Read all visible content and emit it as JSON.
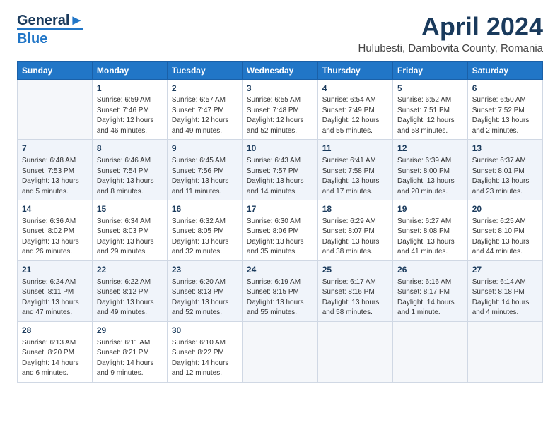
{
  "header": {
    "logo_line1": "General",
    "logo_line2": "Blue",
    "month": "April 2024",
    "location": "Hulubesti, Dambovita County, Romania"
  },
  "weekdays": [
    "Sunday",
    "Monday",
    "Tuesday",
    "Wednesday",
    "Thursday",
    "Friday",
    "Saturday"
  ],
  "weeks": [
    [
      {
        "day": "",
        "sunrise": "",
        "sunset": "",
        "daylight": ""
      },
      {
        "day": "1",
        "sunrise": "Sunrise: 6:59 AM",
        "sunset": "Sunset: 7:46 PM",
        "daylight": "Daylight: 12 hours and 46 minutes."
      },
      {
        "day": "2",
        "sunrise": "Sunrise: 6:57 AM",
        "sunset": "Sunset: 7:47 PM",
        "daylight": "Daylight: 12 hours and 49 minutes."
      },
      {
        "day": "3",
        "sunrise": "Sunrise: 6:55 AM",
        "sunset": "Sunset: 7:48 PM",
        "daylight": "Daylight: 12 hours and 52 minutes."
      },
      {
        "day": "4",
        "sunrise": "Sunrise: 6:54 AM",
        "sunset": "Sunset: 7:49 PM",
        "daylight": "Daylight: 12 hours and 55 minutes."
      },
      {
        "day": "5",
        "sunrise": "Sunrise: 6:52 AM",
        "sunset": "Sunset: 7:51 PM",
        "daylight": "Daylight: 12 hours and 58 minutes."
      },
      {
        "day": "6",
        "sunrise": "Sunrise: 6:50 AM",
        "sunset": "Sunset: 7:52 PM",
        "daylight": "Daylight: 13 hours and 2 minutes."
      }
    ],
    [
      {
        "day": "7",
        "sunrise": "Sunrise: 6:48 AM",
        "sunset": "Sunset: 7:53 PM",
        "daylight": "Daylight: 13 hours and 5 minutes."
      },
      {
        "day": "8",
        "sunrise": "Sunrise: 6:46 AM",
        "sunset": "Sunset: 7:54 PM",
        "daylight": "Daylight: 13 hours and 8 minutes."
      },
      {
        "day": "9",
        "sunrise": "Sunrise: 6:45 AM",
        "sunset": "Sunset: 7:56 PM",
        "daylight": "Daylight: 13 hours and 11 minutes."
      },
      {
        "day": "10",
        "sunrise": "Sunrise: 6:43 AM",
        "sunset": "Sunset: 7:57 PM",
        "daylight": "Daylight: 13 hours and 14 minutes."
      },
      {
        "day": "11",
        "sunrise": "Sunrise: 6:41 AM",
        "sunset": "Sunset: 7:58 PM",
        "daylight": "Daylight: 13 hours and 17 minutes."
      },
      {
        "day": "12",
        "sunrise": "Sunrise: 6:39 AM",
        "sunset": "Sunset: 8:00 PM",
        "daylight": "Daylight: 13 hours and 20 minutes."
      },
      {
        "day": "13",
        "sunrise": "Sunrise: 6:37 AM",
        "sunset": "Sunset: 8:01 PM",
        "daylight": "Daylight: 13 hours and 23 minutes."
      }
    ],
    [
      {
        "day": "14",
        "sunrise": "Sunrise: 6:36 AM",
        "sunset": "Sunset: 8:02 PM",
        "daylight": "Daylight: 13 hours and 26 minutes."
      },
      {
        "day": "15",
        "sunrise": "Sunrise: 6:34 AM",
        "sunset": "Sunset: 8:03 PM",
        "daylight": "Daylight: 13 hours and 29 minutes."
      },
      {
        "day": "16",
        "sunrise": "Sunrise: 6:32 AM",
        "sunset": "Sunset: 8:05 PM",
        "daylight": "Daylight: 13 hours and 32 minutes."
      },
      {
        "day": "17",
        "sunrise": "Sunrise: 6:30 AM",
        "sunset": "Sunset: 8:06 PM",
        "daylight": "Daylight: 13 hours and 35 minutes."
      },
      {
        "day": "18",
        "sunrise": "Sunrise: 6:29 AM",
        "sunset": "Sunset: 8:07 PM",
        "daylight": "Daylight: 13 hours and 38 minutes."
      },
      {
        "day": "19",
        "sunrise": "Sunrise: 6:27 AM",
        "sunset": "Sunset: 8:08 PM",
        "daylight": "Daylight: 13 hours and 41 minutes."
      },
      {
        "day": "20",
        "sunrise": "Sunrise: 6:25 AM",
        "sunset": "Sunset: 8:10 PM",
        "daylight": "Daylight: 13 hours and 44 minutes."
      }
    ],
    [
      {
        "day": "21",
        "sunrise": "Sunrise: 6:24 AM",
        "sunset": "Sunset: 8:11 PM",
        "daylight": "Daylight: 13 hours and 47 minutes."
      },
      {
        "day": "22",
        "sunrise": "Sunrise: 6:22 AM",
        "sunset": "Sunset: 8:12 PM",
        "daylight": "Daylight: 13 hours and 49 minutes."
      },
      {
        "day": "23",
        "sunrise": "Sunrise: 6:20 AM",
        "sunset": "Sunset: 8:13 PM",
        "daylight": "Daylight: 13 hours and 52 minutes."
      },
      {
        "day": "24",
        "sunrise": "Sunrise: 6:19 AM",
        "sunset": "Sunset: 8:15 PM",
        "daylight": "Daylight: 13 hours and 55 minutes."
      },
      {
        "day": "25",
        "sunrise": "Sunrise: 6:17 AM",
        "sunset": "Sunset: 8:16 PM",
        "daylight": "Daylight: 13 hours and 58 minutes."
      },
      {
        "day": "26",
        "sunrise": "Sunrise: 6:16 AM",
        "sunset": "Sunset: 8:17 PM",
        "daylight": "Daylight: 14 hours and 1 minute."
      },
      {
        "day": "27",
        "sunrise": "Sunrise: 6:14 AM",
        "sunset": "Sunset: 8:18 PM",
        "daylight": "Daylight: 14 hours and 4 minutes."
      }
    ],
    [
      {
        "day": "28",
        "sunrise": "Sunrise: 6:13 AM",
        "sunset": "Sunset: 8:20 PM",
        "daylight": "Daylight: 14 hours and 6 minutes."
      },
      {
        "day": "29",
        "sunrise": "Sunrise: 6:11 AM",
        "sunset": "Sunset: 8:21 PM",
        "daylight": "Daylight: 14 hours and 9 minutes."
      },
      {
        "day": "30",
        "sunrise": "Sunrise: 6:10 AM",
        "sunset": "Sunset: 8:22 PM",
        "daylight": "Daylight: 14 hours and 12 minutes."
      },
      {
        "day": "",
        "sunrise": "",
        "sunset": "",
        "daylight": ""
      },
      {
        "day": "",
        "sunrise": "",
        "sunset": "",
        "daylight": ""
      },
      {
        "day": "",
        "sunrise": "",
        "sunset": "",
        "daylight": ""
      },
      {
        "day": "",
        "sunrise": "",
        "sunset": "",
        "daylight": ""
      }
    ]
  ]
}
